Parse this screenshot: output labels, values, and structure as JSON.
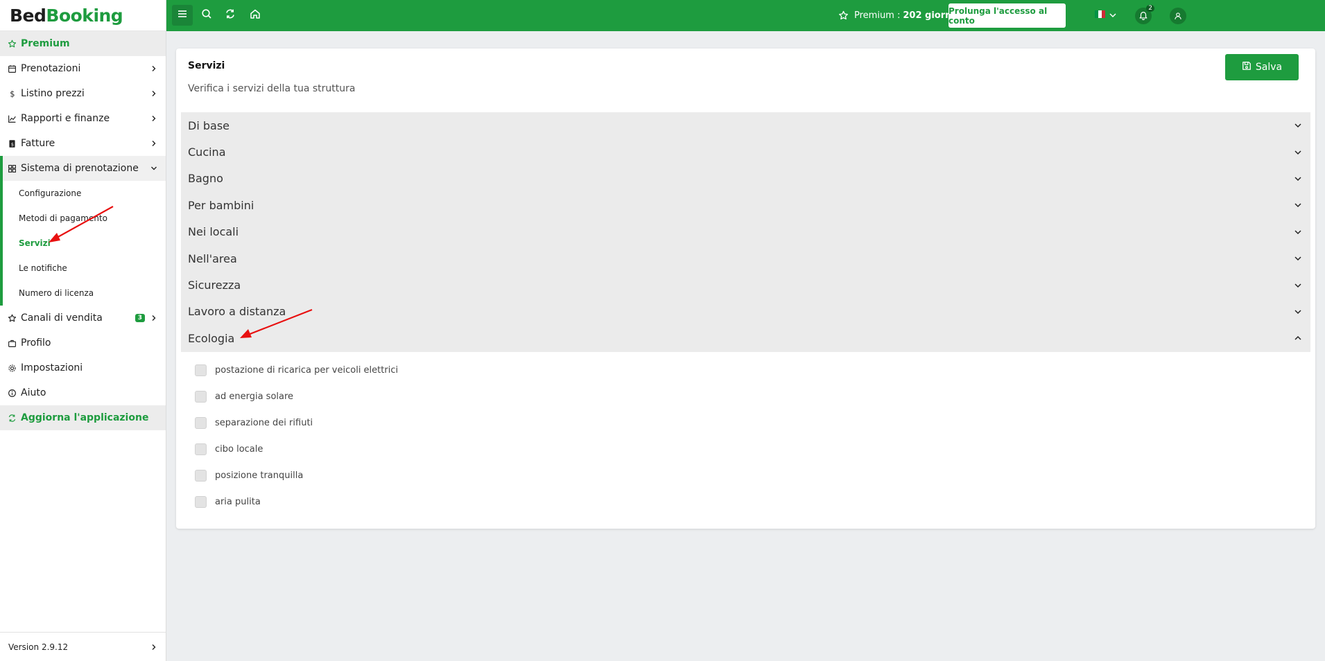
{
  "brand": {
    "part1": "Bed",
    "part2": "Booking"
  },
  "sidebar": {
    "premium": "Premium",
    "items": [
      {
        "label": "Prenotazioni"
      },
      {
        "label": "Listino prezzi"
      },
      {
        "label": "Rapporti e finanze"
      },
      {
        "label": "Fatture"
      },
      {
        "label": "Sistema di prenotazione"
      }
    ],
    "subitems": [
      {
        "label": "Configurazione"
      },
      {
        "label": "Metodi di pagamento"
      },
      {
        "label": "Servizi"
      },
      {
        "label": "Le notifiche"
      },
      {
        "label": "Numero di licenza"
      }
    ],
    "channels": {
      "label": "Canali di vendita",
      "badge": "3"
    },
    "profile": "Profilo",
    "settings": "Impostazioni",
    "help": "Aiuto",
    "update": "Aggiorna l'applicazione",
    "version": "Version 2.9.12"
  },
  "topbar": {
    "premium_label": "Premium :",
    "premium_days": "202 giorni",
    "extend_button": "Prolunga l'accesso al conto",
    "notifications_count": "2"
  },
  "main": {
    "title": "Servizi",
    "subtitle": "Verifica i servizi della tua struttura",
    "save_button": "Salva",
    "sections": [
      {
        "label": "Di base"
      },
      {
        "label": "Cucina"
      },
      {
        "label": "Bagno"
      },
      {
        "label": "Per bambini"
      },
      {
        "label": "Nei locali"
      },
      {
        "label": "Nell'area"
      },
      {
        "label": "Sicurezza"
      },
      {
        "label": "Lavoro a distanza"
      },
      {
        "label": "Ecologia"
      }
    ],
    "ecology_options": [
      {
        "label": "postazione di ricarica per veicoli elettrici"
      },
      {
        "label": "ad energia solare"
      },
      {
        "label": "separazione dei rifiuti"
      },
      {
        "label": "cibo locale"
      },
      {
        "label": "posizione tranquilla"
      },
      {
        "label": "aria pulita"
      }
    ]
  },
  "colors": {
    "accent": "#1e9c3f",
    "annotation": "#e81010"
  }
}
